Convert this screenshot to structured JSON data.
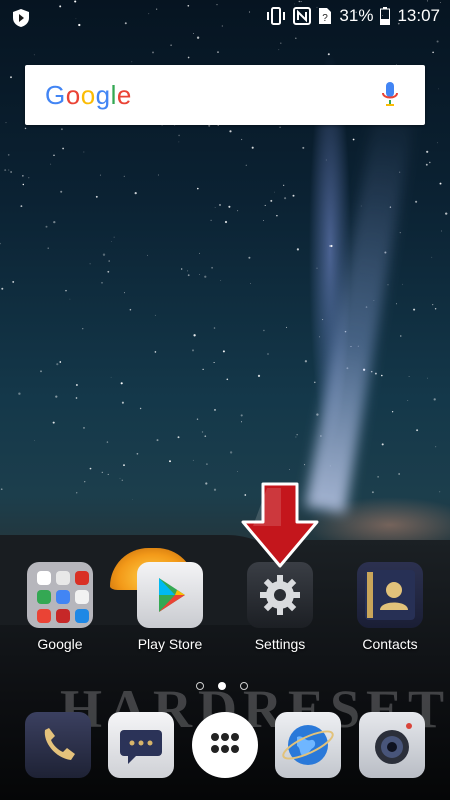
{
  "status_bar": {
    "battery_percent": "31%",
    "time": "13:07",
    "icons": [
      "shield-icon",
      "vibrate-icon",
      "nfc-icon",
      "no-sim-icon",
      "battery-icon"
    ]
  },
  "search": {
    "logo_letters": [
      {
        "char": "G",
        "color": "#4285F4"
      },
      {
        "char": "o",
        "color": "#EA4335"
      },
      {
        "char": "o",
        "color": "#FBBC05"
      },
      {
        "char": "g",
        "color": "#4285F4"
      },
      {
        "char": "l",
        "color": "#34A853"
      },
      {
        "char": "e",
        "color": "#EA4335"
      }
    ],
    "mic_icon": "microphone-icon"
  },
  "apps": [
    {
      "label": "Google",
      "icon": "google-folder-icon"
    },
    {
      "label": "Play Store",
      "icon": "play-store-icon"
    },
    {
      "label": "Settings",
      "icon": "settings-gear-icon"
    },
    {
      "label": "Contacts",
      "icon": "contacts-icon"
    }
  ],
  "watermark": "HARDRESET",
  "pages": {
    "count": 3,
    "active": 2
  },
  "dock": [
    {
      "icon": "phone-icon",
      "color": "#2a2f45"
    },
    {
      "icon": "messages-icon",
      "color": "#e8e8ea"
    },
    {
      "icon": "app-drawer-icon",
      "color": "#ffffff"
    },
    {
      "icon": "browser-icon",
      "color": "#d8dbe0"
    },
    {
      "icon": "camera-icon",
      "color": "#cfd2d8"
    }
  ]
}
